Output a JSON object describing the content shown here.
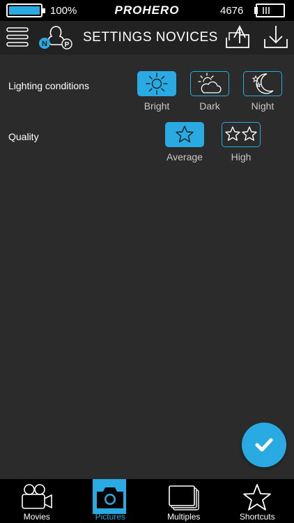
{
  "status_bar": {
    "battery": "100%",
    "brand": "PROHERO",
    "count": "4676"
  },
  "header": {
    "title": "SETTINGS NOVICES"
  },
  "settings": {
    "lighting": {
      "label": "Lighting conditions",
      "options": [
        {
          "label": "Bright",
          "icon": "sun-icon",
          "selected": true
        },
        {
          "label": "Dark",
          "icon": "cloud-sun-icon",
          "selected": false
        },
        {
          "label": "Night",
          "icon": "moon-icon",
          "selected": false
        }
      ]
    },
    "quality": {
      "label": "Quality",
      "options": [
        {
          "label": "Average",
          "icon": "star-icon",
          "selected": true
        },
        {
          "label": "High",
          "icon": "two-stars-icon",
          "selected": false
        }
      ]
    }
  },
  "tabs": [
    {
      "label": "Movies",
      "icon": "video-camera-icon",
      "active": false
    },
    {
      "label": "Pictures",
      "icon": "camera-icon",
      "active": true
    },
    {
      "label": "Multiples",
      "icon": "stacked-photos-icon",
      "active": false
    },
    {
      "label": "Shortcuts",
      "icon": "star-icon",
      "active": false
    }
  ],
  "colors": {
    "accent": "#29aae2",
    "background": "#2b2b2b",
    "bar": "#000000"
  }
}
